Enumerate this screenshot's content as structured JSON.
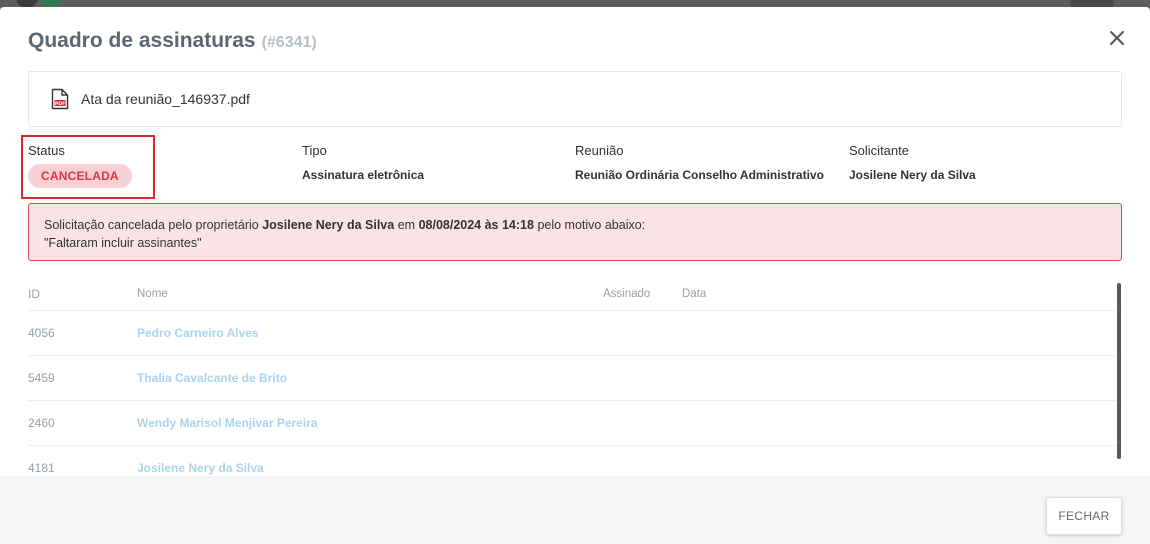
{
  "dialog": {
    "title": "Quadro de assinaturas",
    "id_label": "(#6341)"
  },
  "file": {
    "name": "Ata da reunião_146937.pdf",
    "icon": "pdf-file-icon"
  },
  "info": {
    "status_label": "Status",
    "status_value": "CANCELADA",
    "tipo_label": "Tipo",
    "tipo_value": "Assinatura eletrônica",
    "reuniao_label": "Reunião",
    "reuniao_value": "Reunião Ordinária Conselho Administrativo",
    "solicitante_label": "Solicitante",
    "solicitante_value": "Josilene Nery da Silva"
  },
  "alert": {
    "text_1": "Solicitação cancelada pelo proprietário",
    "owner": "Josilene Nery da Silva",
    "text_2": "em",
    "datetime": "08/08/2024 às 14:18",
    "text_3": "pelo motivo abaixo:",
    "reason": "\"Faltaram incluir assinantes\""
  },
  "table": {
    "headers": {
      "id": "ID",
      "name": "Nome",
      "signed": "Assinado",
      "date": "Data"
    },
    "rows": [
      {
        "id": "4056",
        "name": "Pedro Carneiro Alves"
      },
      {
        "id": "5459",
        "name": "Thalia Cavalcante de Brito"
      },
      {
        "id": "2460",
        "name": "Wendy Marisol Menjivar Pereira"
      },
      {
        "id": "4181",
        "name": "Josilene Nery da Silva"
      }
    ]
  },
  "footer": {
    "close_label": "FECHAR"
  },
  "colors": {
    "status_badge_bg": "#f6d0d4",
    "status_badge_text": "#d9363e",
    "alert_bg": "#f9e4e5",
    "alert_border": "#d34a50",
    "highlight_border": "#d9292b",
    "name_link": "#a9d3f0"
  }
}
